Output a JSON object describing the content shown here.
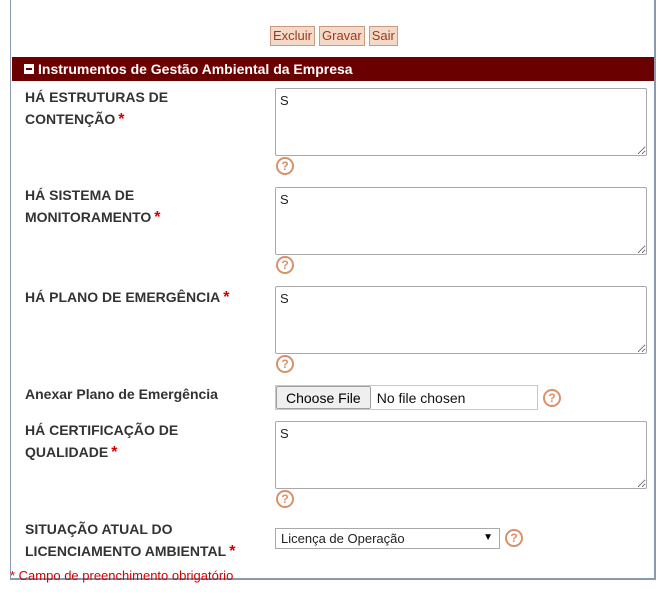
{
  "toolbar": {
    "delete_label": "Excluir",
    "save_label": "Gravar",
    "exit_label": "Sair"
  },
  "section": {
    "title": "Instrumentos de Gestão Ambiental da Empresa"
  },
  "fields": {
    "containment": {
      "label_line1": "HÁ ESTRUTURAS DE",
      "label_line2": "CONTENÇÃO",
      "value": "S"
    },
    "monitoring": {
      "label_line1": "HÁ SISTEMA DE",
      "label_line2": "MONITORAMENTO",
      "value": "S"
    },
    "emergency": {
      "label": "HÁ PLANO DE EMERGÊNCIA",
      "value": "S"
    },
    "attach": {
      "label": "Anexar Plano de Emergência",
      "button": "Choose File",
      "status": "No file chosen"
    },
    "certification": {
      "label_line1": "HÁ CERTIFICAÇÃO DE",
      "label_line2": "QUALIDADE",
      "value": "S"
    },
    "licensing": {
      "label_line1": "SITUAÇÃO ATUAL DO",
      "label_line2": "LICENCIAMENTO AMBIENTAL",
      "value": "Licença de Operação"
    }
  },
  "required_marker": "*",
  "help_glyph": "?",
  "footnote": "* Campo de preenchimento obrigatório",
  "colors": {
    "header_bg": "#6a0000",
    "required": "#d40000",
    "help": "#d9916a",
    "button_bg": "#f4d9c8"
  }
}
